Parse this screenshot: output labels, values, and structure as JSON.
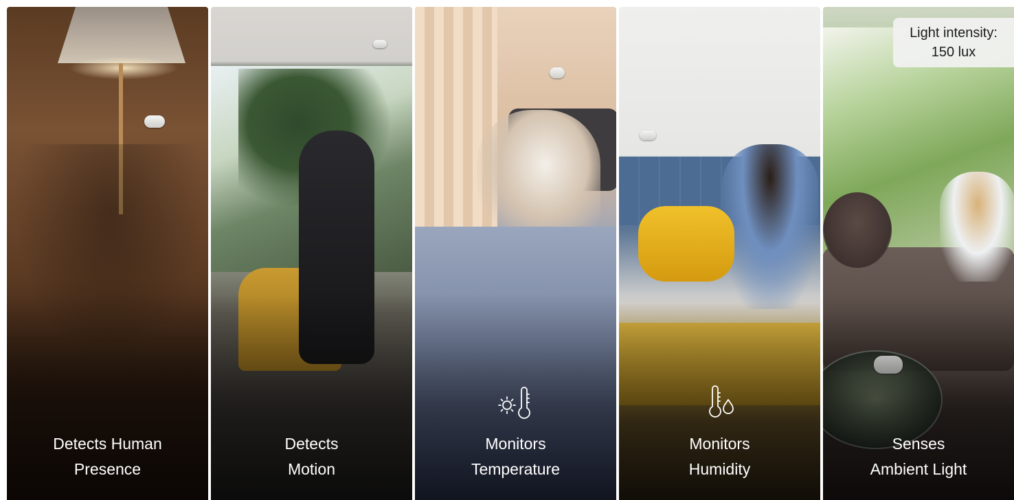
{
  "panels": [
    {
      "line1": "Detects Human",
      "line2": "Presence",
      "icon": null
    },
    {
      "line1": "Detects",
      "line2": "Motion",
      "icon": null
    },
    {
      "line1": "Monitors",
      "line2": "Temperature",
      "icon": "sun-thermometer-icon"
    },
    {
      "line1": "Monitors",
      "line2": "Humidity",
      "icon": "thermometer-droplet-icon"
    },
    {
      "line1": "Senses",
      "line2": "Ambient Light",
      "icon": null
    }
  ],
  "light_badge": {
    "label": "Light intensity:",
    "value": "150 lux"
  },
  "colors": {
    "caption_text": "#ffffff",
    "badge_bg": "#f2f2f2",
    "badge_text": "#1b1b1b"
  }
}
